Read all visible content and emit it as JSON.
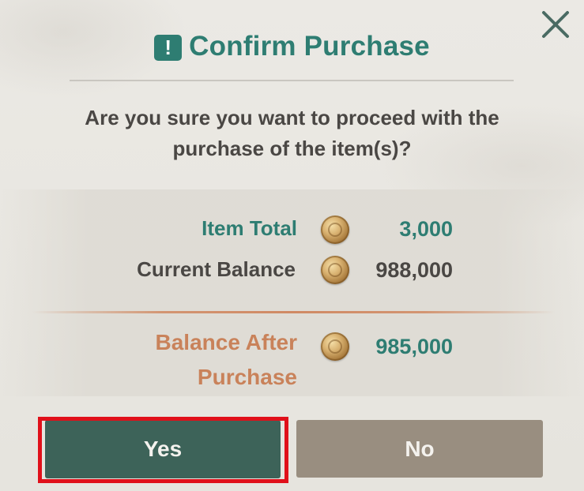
{
  "dialog": {
    "title": "Confirm Purchase",
    "title_icon": "exclamation-icon",
    "title_icon_glyph": "!",
    "close_icon": "close-icon",
    "question": "Are you sure you want to proceed with the purchase of the item(s)?",
    "currency_icon": "gold-coin-icon"
  },
  "summary": {
    "item_total_label": "Item Total",
    "item_total_value": "3,000",
    "current_balance_label": "Current Balance",
    "current_balance_value": "988,000",
    "balance_after_label": "Balance After Purchase",
    "balance_after_value": "985,000"
  },
  "buttons": {
    "yes_label": "Yes",
    "no_label": "No"
  },
  "colors": {
    "accent_teal": "#2e7d72",
    "yes_button": "#3d6359",
    "no_button": "#998e80",
    "balance_after": "#c9825a",
    "highlight": "#e0101a"
  }
}
